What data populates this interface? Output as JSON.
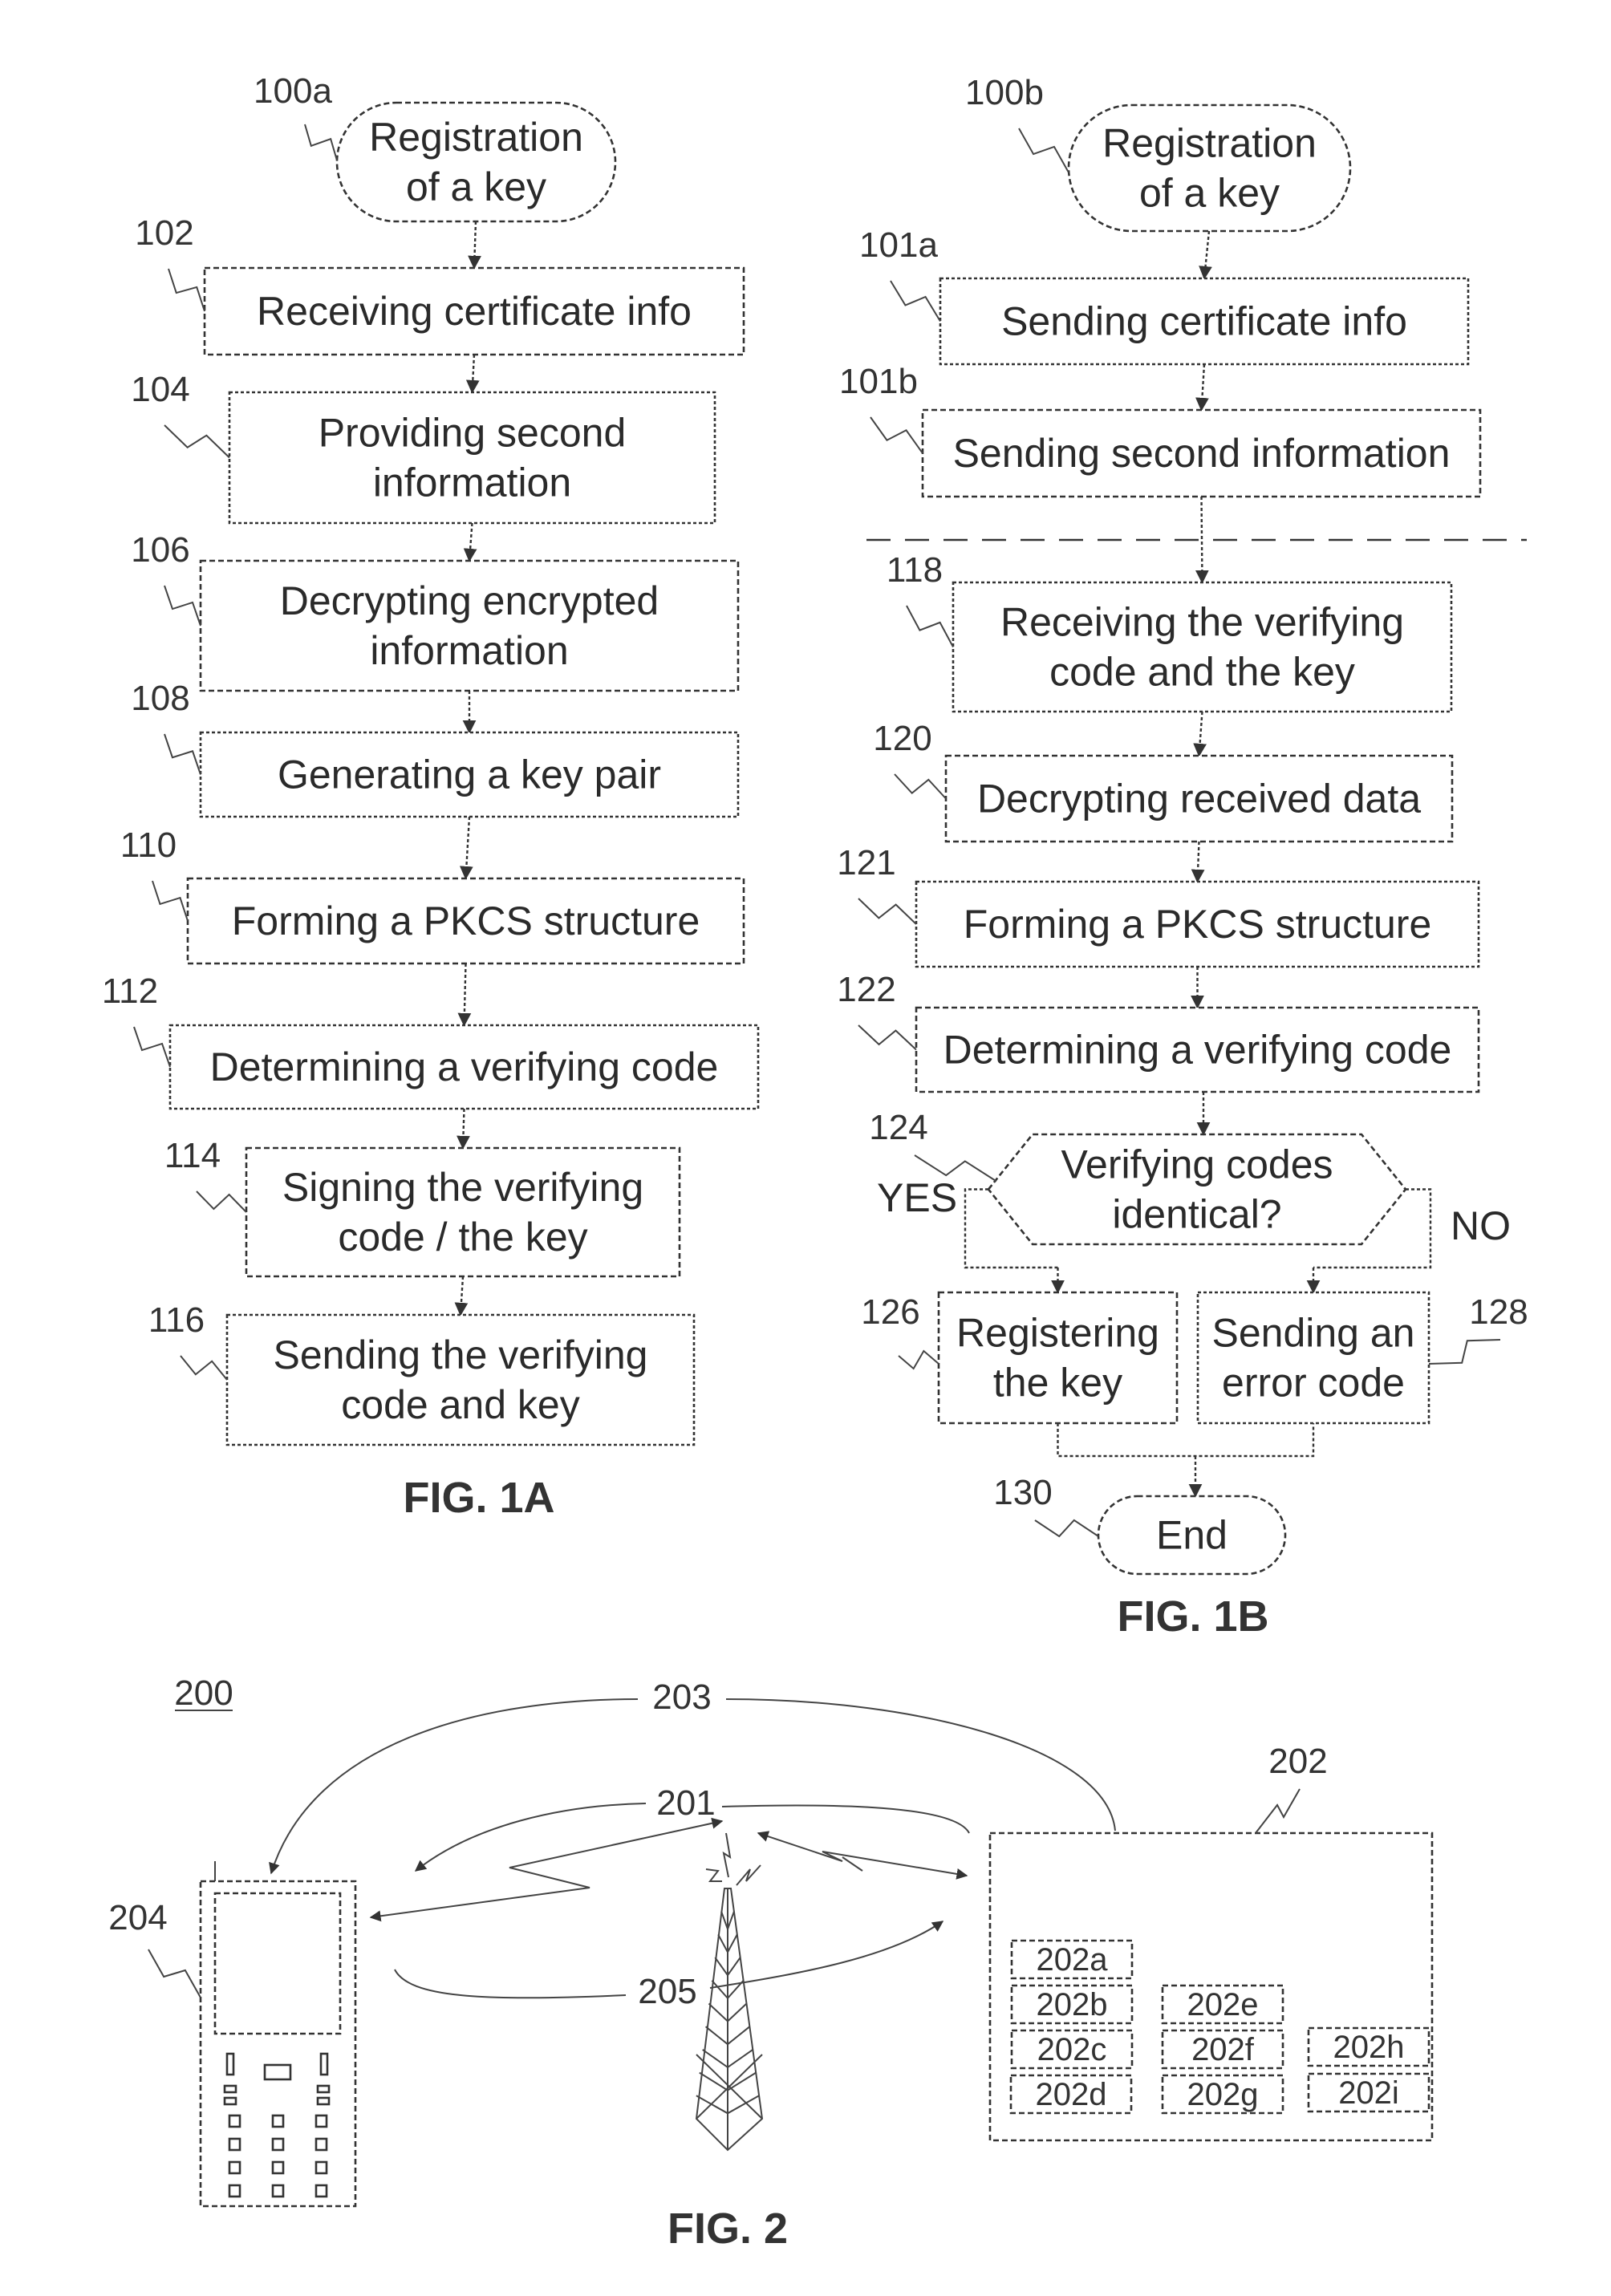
{
  "fig1a": {
    "caption": "FIG. 1A",
    "start": {
      "ref": "100a",
      "lines": [
        "Registration",
        "of a key"
      ]
    },
    "steps": [
      {
        "ref": "102",
        "lines": [
          "Receiving certificate info"
        ]
      },
      {
        "ref": "104",
        "lines": [
          "Providing second",
          "information"
        ]
      },
      {
        "ref": "106",
        "lines": [
          "Decrypting encrypted",
          "information"
        ]
      },
      {
        "ref": "108",
        "lines": [
          "Generating a key pair"
        ]
      },
      {
        "ref": "110",
        "lines": [
          "Forming a PKCS structure"
        ]
      },
      {
        "ref": "112",
        "lines": [
          "Determining a verifying code"
        ]
      },
      {
        "ref": "114",
        "lines": [
          "Signing the verifying",
          "code / the key"
        ]
      },
      {
        "ref": "116",
        "lines": [
          "Sending the verifying",
          "code and key"
        ]
      }
    ]
  },
  "fig1b": {
    "caption": "FIG. 1B",
    "start": {
      "ref": "100b",
      "lines": [
        "Registration",
        "of a key"
      ]
    },
    "steps": [
      {
        "ref": "101a",
        "lines": [
          "Sending certificate info"
        ]
      },
      {
        "ref": "101b",
        "lines": [
          "Sending second information"
        ]
      },
      {
        "ref": "118",
        "lines": [
          "Receiving the verifying",
          "code and the key"
        ]
      },
      {
        "ref": "120",
        "lines": [
          "Decrypting received data"
        ]
      },
      {
        "ref": "121",
        "lines": [
          "Forming a PKCS  structure"
        ]
      },
      {
        "ref": "122",
        "lines": [
          "Determining a verifying code"
        ]
      }
    ],
    "decision": {
      "ref": "124",
      "lines": [
        "Verifying codes",
        "identical?"
      ],
      "yes_label": "YES",
      "no_label": "NO"
    },
    "yes_step": {
      "ref": "126",
      "lines": [
        "Registering",
        "the key"
      ]
    },
    "no_step": {
      "ref": "128",
      "lines": [
        "Sending an",
        "error code"
      ]
    },
    "end": {
      "ref": "130",
      "lines": [
        "End"
      ]
    }
  },
  "fig2": {
    "caption": "FIG. 2",
    "system_ref": "200",
    "link_refs": {
      "top": "203",
      "middle": "201",
      "bottom": "205"
    },
    "phone_ref": "204",
    "server": {
      "ref": "202",
      "modules": [
        "202a",
        "202b",
        "202c",
        "202d",
        "202e",
        "202f",
        "202g",
        "202h",
        "202i"
      ]
    }
  }
}
